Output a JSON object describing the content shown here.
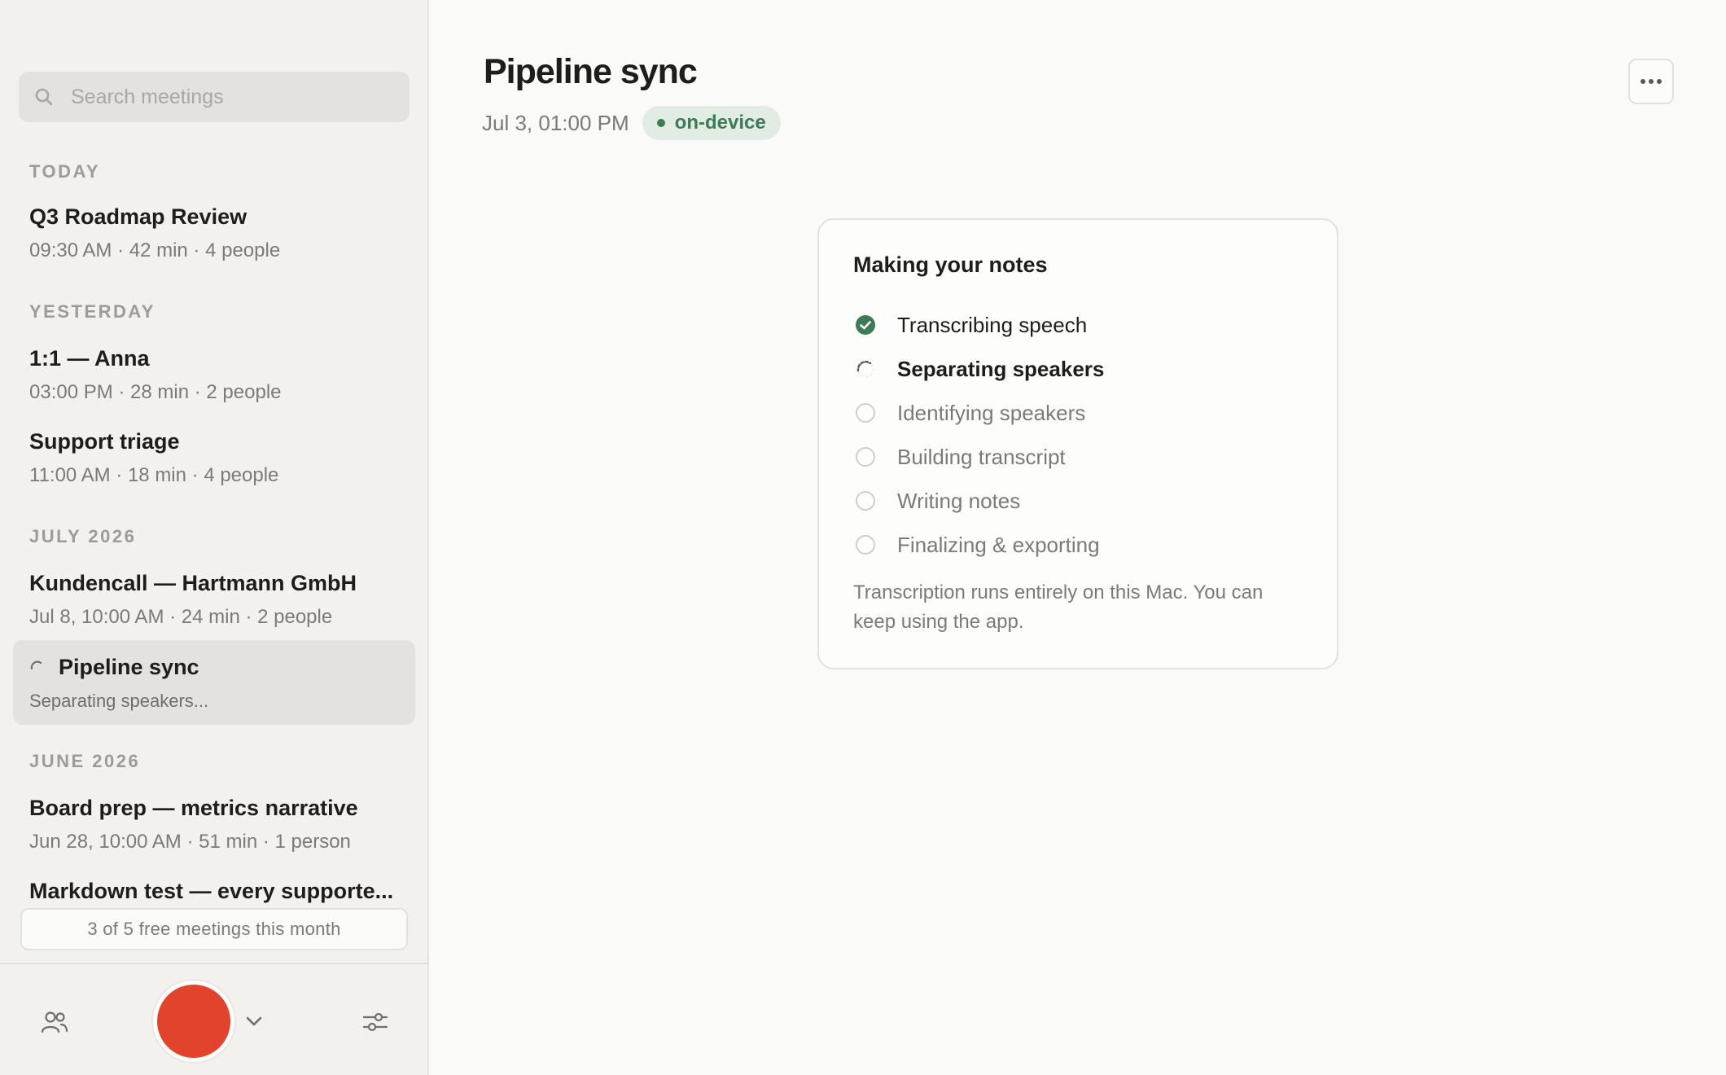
{
  "sidebar": {
    "search_placeholder": "Search meetings",
    "sections": [
      {
        "label": "TODAY"
      },
      {
        "label": "YESTERDAY"
      },
      {
        "label": "JULY 2026"
      },
      {
        "label": "JUNE 2026"
      }
    ],
    "meetings": [
      {
        "title": "Q3 Roadmap Review",
        "meta": "09:30 AM · 42 min · 4 people"
      },
      {
        "title": "1:1 — Anna",
        "meta": "03:00 PM · 28 min · 2 people"
      },
      {
        "title": "Support triage",
        "meta": "11:00 AM · 18 min · 4 people"
      },
      {
        "title": "Kundencall — Hartmann GmbH",
        "meta": "Jul 8, 10:00 AM · 24 min · 2 people"
      },
      {
        "title": "Pipeline sync",
        "meta": "Separating speakers..."
      },
      {
        "title": "Board prep — metrics narrative",
        "meta": "Jun 28, 10:00 AM · 51 min · 1 person"
      },
      {
        "title": "Markdown test — every supporte..."
      }
    ],
    "quota_text": "3 of 5 free meetings this month"
  },
  "meeting": {
    "title": "Pipeline sync",
    "datetime": "Jul 3, 01:00 PM",
    "badge": "on-device"
  },
  "progress": {
    "heading": "Making your notes",
    "steps": [
      {
        "label": "Transcribing speech",
        "status": "done"
      },
      {
        "label": "Separating speakers",
        "status": "in-progress"
      },
      {
        "label": "Identifying speakers",
        "status": "pending"
      },
      {
        "label": "Building transcript",
        "status": "pending"
      },
      {
        "label": "Writing notes",
        "status": "pending"
      },
      {
        "label": "Finalizing & exporting",
        "status": "pending"
      }
    ],
    "note": "Transcription runs entirely on this Mac. You can keep using the app."
  },
  "colors": {
    "accent_green": "#3e7a55",
    "record_red": "#e2432b"
  },
  "icons": [
    "search-icon",
    "people-icon",
    "chevron-down-icon",
    "sliders-icon",
    "more-icon",
    "check-circle-icon",
    "spinner-icon",
    "empty-circle-icon"
  ]
}
